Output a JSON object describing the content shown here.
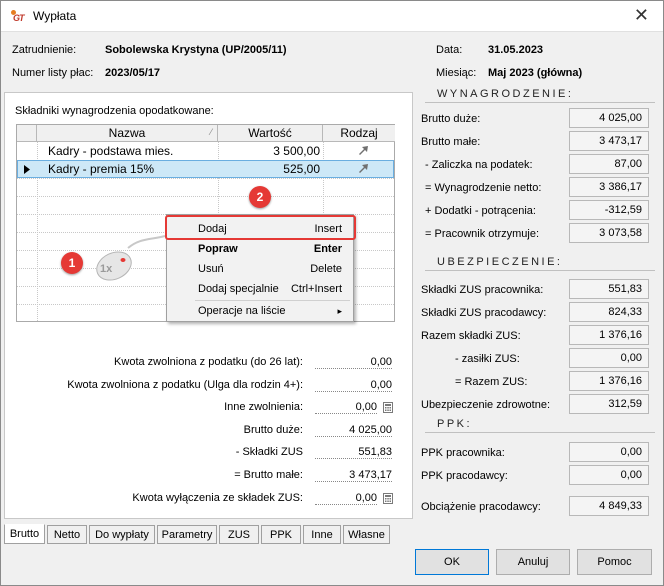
{
  "window": {
    "title": "Wypłata",
    "app_icon": "app-logo-icon",
    "close_label": "✕"
  },
  "header": {
    "employment_label": "Zatrudnienie:",
    "employment_value": "Sobolewska Krystyna (UP/2005/11)",
    "list_label": "Numer listy płac:",
    "list_value": "2023/05/17",
    "date_label": "Data:",
    "date_value": "31.05.2023",
    "month_label": "Miesiąc:",
    "month_value": "Maj 2023 (główna)"
  },
  "components": {
    "title": "Składniki wynagrodzenia opodatkowane:",
    "columns": [
      "Nazwa",
      "Wartość",
      "Rodzaj"
    ],
    "rows": [
      {
        "name": "Kadry - podstawa mies.",
        "value": "3 500,00",
        "kind": "arrow-up-right-icon"
      },
      {
        "name": "Kadry - premia 15%",
        "value": "525,00",
        "kind": "arrow-up-right-icon",
        "selected": true
      }
    ]
  },
  "context_menu": {
    "items": [
      {
        "label": "Dodaj",
        "shortcut": "Insert"
      },
      {
        "label": "Popraw",
        "shortcut": "Enter"
      },
      {
        "label": "Usuń",
        "shortcut": "Delete"
      },
      {
        "label": "Dodaj specjalnie",
        "shortcut": "Ctrl+Insert"
      },
      {
        "label": "Operacje na liście",
        "shortcut": "▸"
      }
    ]
  },
  "annotations": {
    "badge1": "1",
    "badge2": "2",
    "mouse_hint": "1x"
  },
  "summary": {
    "rows": [
      {
        "label": "Kwota zwolniona z podatku (do 26 lat):",
        "value": "0,00"
      },
      {
        "label": "Kwota zwolniona z podatku (Ulga dla rodzin 4+):",
        "value": "0,00"
      },
      {
        "label": "Inne zwolnienia:",
        "value": "0,00"
      },
      {
        "label": "Brutto duże:",
        "value": "4 025,00"
      },
      {
        "label": "-  Składki ZUS",
        "value": "551,83"
      },
      {
        "label": "= Brutto małe:",
        "value": "3 473,17"
      },
      {
        "label": "Kwota wyłączenia ze składek ZUS:",
        "value": "0,00"
      }
    ]
  },
  "wynagrodzenie": {
    "title": "WYNAGRODZENIE:",
    "rows": [
      {
        "label": "Brutto duże:",
        "value": "4 025,00"
      },
      {
        "label": "Brutto małe:",
        "value": "3 473,17"
      },
      {
        "label": "- Zaliczka na podatek:",
        "value": "87,00"
      },
      {
        "label": "= Wynagrodzenie netto:",
        "value": "3 386,17"
      },
      {
        "label": "+ Dodatki - potrącenia:",
        "value": "-312,59"
      },
      {
        "label": "= Pracownik otrzymuje:",
        "value": "3 073,58"
      }
    ]
  },
  "ubezpieczenie": {
    "title": "UBEZPIECZENIE:",
    "rows": [
      {
        "label": "Składki ZUS pracownika:",
        "value": "551,83"
      },
      {
        "label": "Składki ZUS pracodawcy:",
        "value": "824,33"
      },
      {
        "label": "Razem składki ZUS:",
        "value": "1 376,16"
      },
      {
        "label": "- zasiłki ZUS:",
        "value": "0,00"
      },
      {
        "label": "= Razem ZUS:",
        "value": "1 376,16"
      },
      {
        "label": "Ubezpieczenie zdrowotne:",
        "value": "312,59"
      }
    ]
  },
  "ppk": {
    "title": "PPK:",
    "rows": [
      {
        "label": "PPK pracownika:",
        "value": "0,00"
      },
      {
        "label": "PPK pracodawcy:",
        "value": "0,00"
      },
      {
        "label": "Obciążenie pracodawcy:",
        "value": "4 849,33"
      }
    ]
  },
  "tabs": [
    "Brutto",
    "Netto",
    "Do wypłaty",
    "Parametry",
    "ZUS",
    "PPK",
    "Inne",
    "Własne"
  ],
  "buttons": {
    "ok": "OK",
    "cancel": "Anuluj",
    "help": "Pomoc"
  }
}
